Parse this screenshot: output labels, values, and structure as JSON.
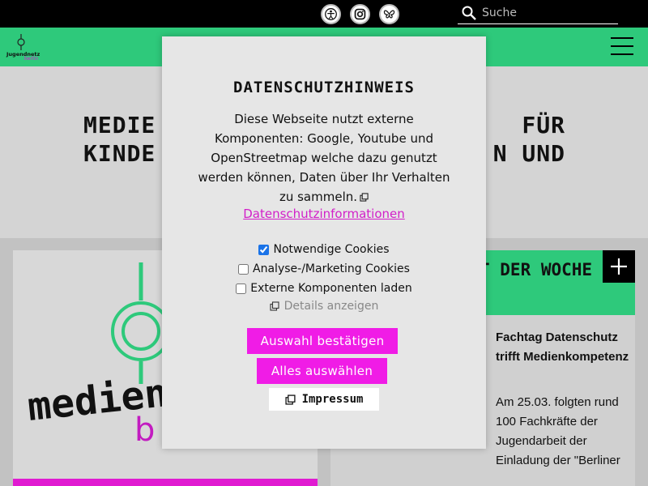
{
  "topbar": {
    "social": [
      {
        "name": "ethical-badge-icon"
      },
      {
        "name": "instagram-icon"
      },
      {
        "name": "butterfly-icon"
      }
    ],
    "search_placeholder": "Suche"
  },
  "logo": {
    "line1": "Jugendnetz",
    "line2": "berlin"
  },
  "hero": {
    "line_left_1": "MEDIE",
    "line_left_2": "KINDE",
    "line_right_1": "FÜR",
    "line_right_2": "N UND"
  },
  "card_right": {
    "header": "T DER WOCHE",
    "news_title": "Fachtag Datenschutz trifft Medienkompetenz",
    "news_text": "Am 25.03. folgten rund 100 Fachkräfte der Jugendarbeit der Einladung der \"Berliner"
  },
  "card_left": {
    "wordmark": "medien.",
    "sub": "b"
  },
  "modal": {
    "title": "DATENSCHUTZHINWEIS",
    "intro": "Diese Webseite nutzt externe Komponenten: Google, Youtube und OpenStreetmap welche dazu genutzt werden können, Daten über Ihr Verhalten zu sammeln.",
    "privacy_link": "Datenschutzinformationen",
    "options": [
      {
        "label": "Notwendige Cookies",
        "checked": true
      },
      {
        "label": "Analyse-/Marketing Cookies",
        "checked": false
      },
      {
        "label": "Externe Komponenten laden",
        "checked": false
      }
    ],
    "details_label": "Details anzeigen",
    "confirm_label": "Auswahl bestätigen",
    "accept_all_label": "Alles auswählen",
    "imprint_label": "Impressum"
  },
  "colors": {
    "green": "#2ec97b",
    "pink": "#f01ce6",
    "link_pink": "#d21fc9",
    "black": "#000000"
  }
}
